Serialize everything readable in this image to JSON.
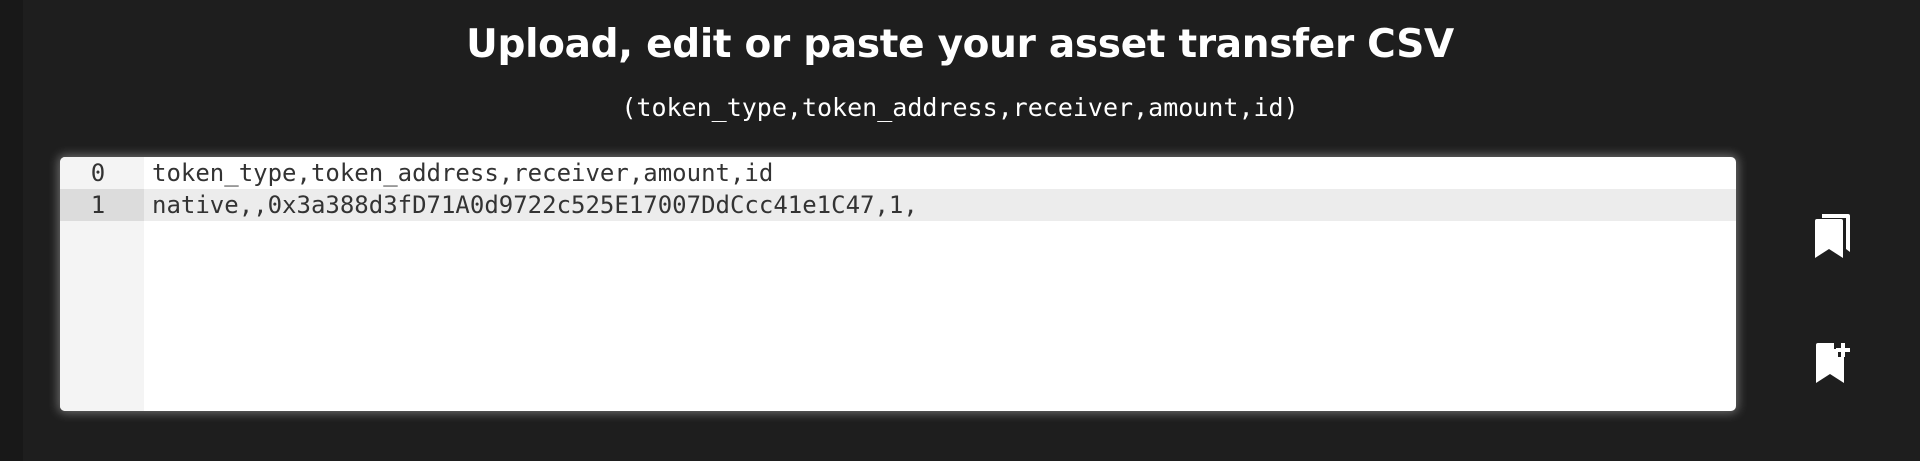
{
  "header": {
    "title": "Upload, edit or paste your asset transfer CSV",
    "format_hint": "(token_type,token_address,receiver,amount,id)"
  },
  "editor": {
    "lines": [
      {
        "number": "0",
        "text": "token_type,token_address,receiver,amount,id",
        "active": false
      },
      {
        "number": "1",
        "text": "native,,0x3a388d3fD71A0d9722c525E17007DdCcc41e1C47,1,",
        "active": true
      }
    ]
  },
  "actions": {
    "saved_icon": "bookmarks-icon",
    "add_icon": "bookmark-add-icon"
  },
  "colors": {
    "background": "#1e1e1e",
    "editor_bg": "#ffffff",
    "gutter_bg": "#f4f4f4",
    "active_line": "#ececec"
  }
}
